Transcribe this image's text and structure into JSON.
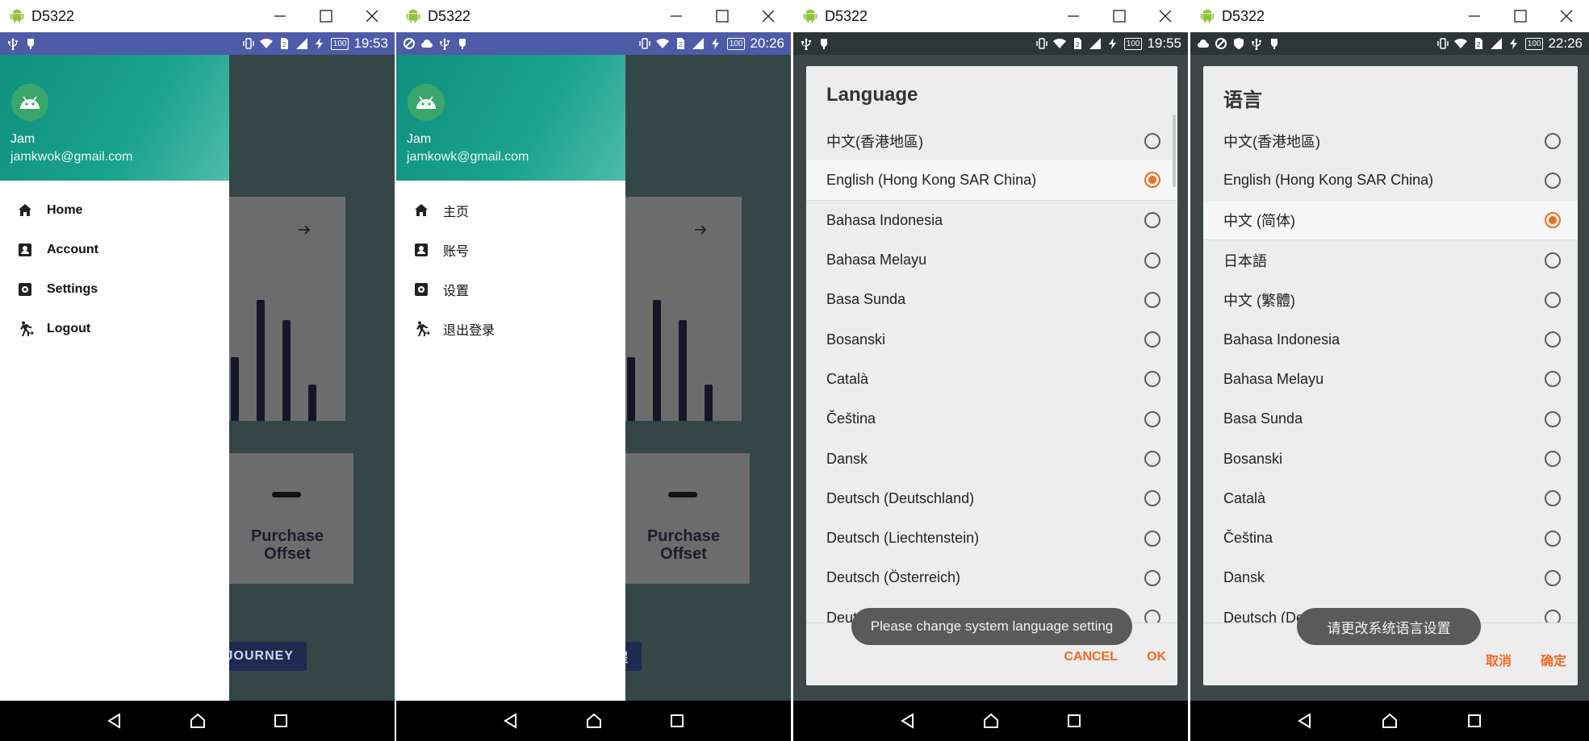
{
  "colors": {
    "status_bar_drawer": "#4e5ba6",
    "status_bar_dialog": "#2c3636",
    "accent": "#f26a21",
    "drawer_header": "#139682",
    "nav_bar": "#000000",
    "journey_button": "#1e2a52"
  },
  "windows": [
    {
      "title": "D5322",
      "status": {
        "time": "19:53",
        "battery": "100"
      },
      "drawer": {
        "name": "Jam",
        "email": "jamkwok@gmail.com",
        "items": [
          {
            "icon": "home-icon",
            "label": "Home"
          },
          {
            "icon": "account-icon",
            "label": "Account"
          },
          {
            "icon": "settings-icon",
            "label": "Settings"
          },
          {
            "icon": "logout-icon",
            "label": "Logout"
          }
        ]
      },
      "background": {
        "purchase_label": "Purchase Offset",
        "journey_label": "JOURNEY"
      }
    },
    {
      "title": "D5322",
      "status": {
        "time": "20:26",
        "battery": "100"
      },
      "drawer": {
        "name": "Jam",
        "email": "jamkowk@gmail.com",
        "items": [
          {
            "icon": "home-icon",
            "label": "主页"
          },
          {
            "icon": "account-icon",
            "label": "账号"
          },
          {
            "icon": "settings-icon",
            "label": "设置"
          },
          {
            "icon": "logout-icon",
            "label": "退出登录"
          }
        ]
      },
      "background": {
        "purchase_label": "Purchase Offset",
        "journey_label": "程"
      }
    },
    {
      "title": "D5322",
      "status": {
        "time": "19:55",
        "battery": "100"
      },
      "dialog": {
        "title": "Language",
        "options": [
          "中文(香港地區)",
          "English (Hong Kong SAR China)",
          "Bahasa Indonesia",
          "Bahasa Melayu",
          "Basa Sunda",
          "Bosanski",
          "Català",
          "Čeština",
          "Dansk",
          "Deutsch (Deutschland)",
          "Deutsch (Liechtenstein)",
          "Deutsch (Österreich)",
          "Deutsch (Schweiz)"
        ],
        "selected_index": 1,
        "cancel_label": "CANCEL",
        "ok_label": "OK",
        "toast": "Please change system language setting"
      }
    },
    {
      "title": "D5322",
      "status": {
        "time": "22:26",
        "battery": "100"
      },
      "dialog": {
        "title": "语言",
        "options": [
          "中文(香港地區)",
          "English (Hong Kong SAR China)",
          "中文 (简体)",
          "日本語",
          "中文 (繁體)",
          "Bahasa Indonesia",
          "Bahasa Melayu",
          "Basa Sunda",
          "Bosanski",
          "Català",
          "Čeština",
          "Dansk",
          "Deutsch (Deutschland)"
        ],
        "selected_index": 2,
        "cancel_label": "取消",
        "ok_label": "确定",
        "toast": "请更改系统语言设置"
      }
    }
  ]
}
